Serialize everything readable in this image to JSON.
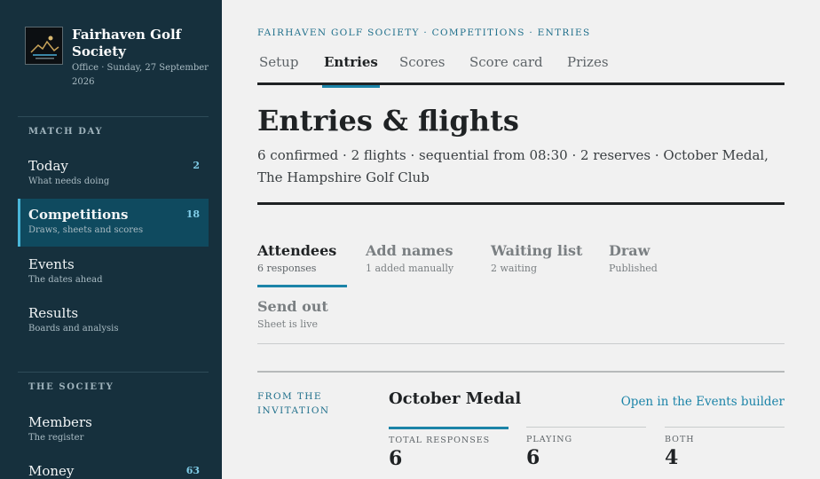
{
  "sidebar": {
    "brand": {
      "name": "Fairhaven Golf Society",
      "subtitle": "Office · Sunday, 27 September 2026",
      "logo_icon": "golf-logo-icon"
    },
    "sections": [
      {
        "heading": "MATCH DAY",
        "items": [
          {
            "label": "Today",
            "sub": "What needs doing",
            "count": "2",
            "active": false
          },
          {
            "label": "Competitions",
            "sub": "Draws, sheets and scores",
            "count": "18",
            "active": true
          },
          {
            "label": "Events",
            "sub": "The dates ahead",
            "count": "",
            "active": false
          },
          {
            "label": "Results",
            "sub": "Boards and analysis",
            "count": "",
            "active": false
          }
        ]
      },
      {
        "heading": "THE SOCIETY",
        "items": [
          {
            "label": "Members",
            "sub": "The register",
            "count": "",
            "active": false
          },
          {
            "label": "Money",
            "sub": "",
            "count": "63",
            "active": false
          }
        ]
      }
    ]
  },
  "main": {
    "breadcrumb": "FAIRHAVEN GOLF SOCIETY · COMPETITIONS · ENTRIES",
    "tabs": [
      {
        "label": "Setup",
        "active": false
      },
      {
        "label": "Entries",
        "active": true
      },
      {
        "label": "Scores",
        "active": false
      },
      {
        "label": "Score card",
        "active": false
      },
      {
        "label": "Prizes",
        "active": false
      }
    ],
    "title": "Entries & flights",
    "subtitle": "6 confirmed · 2 flights · sequential from 08:30 · 2 reserves · October Medal, The Hampshire Golf Club",
    "subtabs": [
      {
        "label": "Attendees",
        "sub": "6 responses",
        "active": true
      },
      {
        "label": "Add names",
        "sub": "1 added manually",
        "active": false
      },
      {
        "label": "Waiting list",
        "sub": "2 waiting",
        "active": false
      },
      {
        "label": "Draw",
        "sub": "Published",
        "active": false
      },
      {
        "label": "Send out",
        "sub": "Sheet is live",
        "active": false
      }
    ],
    "invitation": {
      "from_label": "FROM THE INVITATION",
      "event_name": "October Medal",
      "open_link": "Open in the Events builder",
      "stats": [
        {
          "label": "TOTAL RESPONSES",
          "value": "6",
          "active": true
        },
        {
          "label": "PLAYING",
          "value": "6",
          "active": false
        },
        {
          "label": "BOTH",
          "value": "4",
          "active": false
        }
      ]
    }
  },
  "colors": {
    "sidebar_bg": "#16303d",
    "accent": "#1c84a8",
    "active_nav_bg": "#0f4a5f",
    "page_bg": "#f1f1f1"
  }
}
